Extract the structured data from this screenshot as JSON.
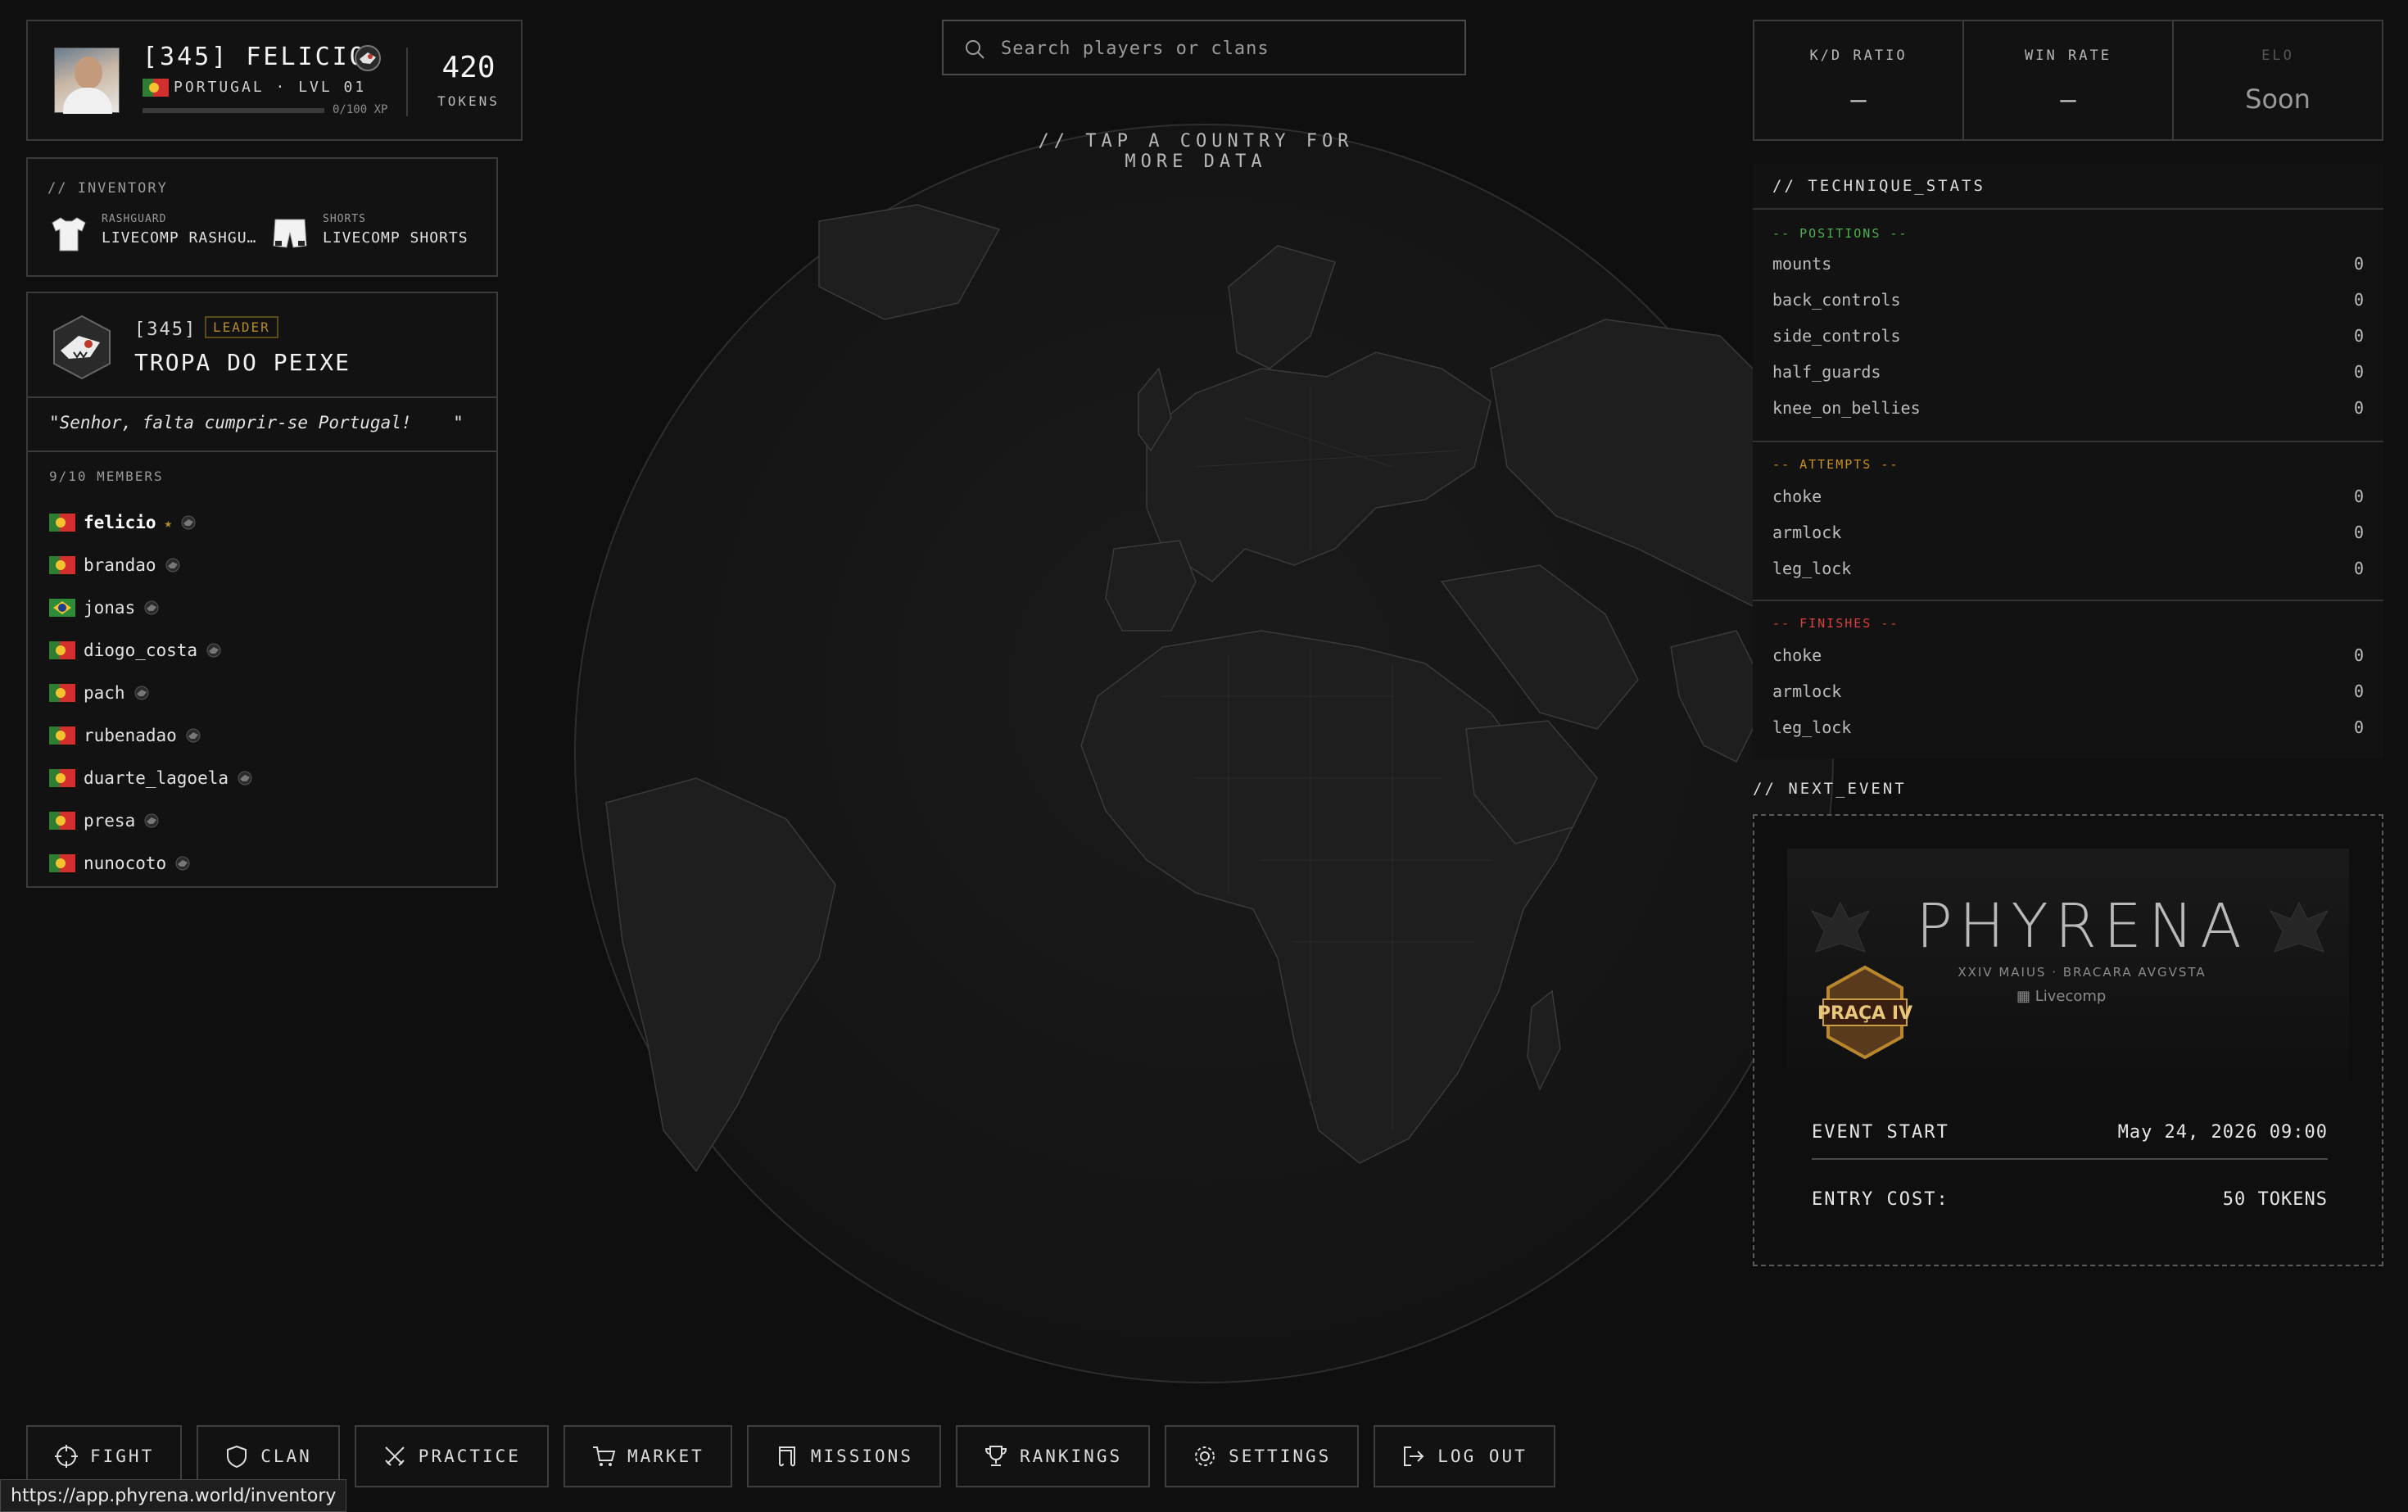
{
  "profile": {
    "name": "[345] FELICIO",
    "country_level": "PORTUGAL · LVL 01",
    "xp_text": "0/100 XP",
    "xp_progress": 0.0,
    "tokens_value": "420",
    "tokens_label": "TOKENS"
  },
  "inventory": {
    "title": "// INVENTORY",
    "items": [
      {
        "type": "RASHGUARD",
        "name": "LIVECOMP RASHGU…"
      },
      {
        "type": "SHORTS",
        "name": "LIVECOMP SHORTS"
      }
    ]
  },
  "clan": {
    "tag": "[345]",
    "role": "LEADER",
    "name": "TROPA DO PEIXE",
    "motto": "\"Senhor, falta cumprir-se Portugal!    \"",
    "members_count": "9/10 MEMBERS",
    "members": [
      {
        "name": "felicio",
        "flag": "pt",
        "leader": true
      },
      {
        "name": "brandao",
        "flag": "pt",
        "leader": false
      },
      {
        "name": "jonas",
        "flag": "br",
        "leader": false
      },
      {
        "name": "diogo_costa",
        "flag": "pt",
        "leader": false
      },
      {
        "name": "pach",
        "flag": "pt",
        "leader": false
      },
      {
        "name": "rubenadao",
        "flag": "pt",
        "leader": false
      },
      {
        "name": "duarte_lagoela",
        "flag": "pt",
        "leader": false
      },
      {
        "name": "presa",
        "flag": "pt",
        "leader": false
      },
      {
        "name": "nunocoto",
        "flag": "pt",
        "leader": false
      }
    ],
    "leader_star": "★"
  },
  "search": {
    "placeholder": "Search players or clans"
  },
  "map": {
    "hint": "// TAP A COUNTRY FOR MORE DATA"
  },
  "stats": [
    {
      "label": "K/D RATIO",
      "value": "—"
    },
    {
      "label": "WIN RATE",
      "value": "—"
    },
    {
      "label": "ELO",
      "value": "Soon"
    }
  ],
  "technique": {
    "title": "// TECHNIQUE_STATS",
    "groups": [
      {
        "title": "-- POSITIONS --",
        "color": "#4caf50",
        "rows": [
          [
            "mounts",
            "0"
          ],
          [
            "back_controls",
            "0"
          ],
          [
            "side_controls",
            "0"
          ],
          [
            "half_guards",
            "0"
          ],
          [
            "knee_on_bellies",
            "0"
          ]
        ]
      },
      {
        "title": "-- ATTEMPTS --",
        "color": "#c99020",
        "rows": [
          [
            "choke",
            "0"
          ],
          [
            "armlock",
            "0"
          ],
          [
            "leg_lock",
            "0"
          ]
        ]
      },
      {
        "title": "-- FINISHES --",
        "color": "#d64040",
        "rows": [
          [
            "choke",
            "0"
          ],
          [
            "armlock",
            "0"
          ],
          [
            "leg_lock",
            "0"
          ]
        ]
      }
    ]
  },
  "next_event": {
    "title": "// NEXT_EVENT",
    "banner_brand": "PHYRENA",
    "banner_sub": "XXIV MAIUS · BRACARA AVGVSTA",
    "banner_partner": "Livecomp",
    "banner_badge": "PRAÇA IV",
    "start_label": "EVENT START",
    "start_value": "May 24, 2026 09:00",
    "cost_label": "ENTRY COST:",
    "cost_value": "50 TOKENS"
  },
  "nav": [
    {
      "label": "FIGHT",
      "icon": "crosshair-icon"
    },
    {
      "label": "CLAN",
      "icon": "shield-icon"
    },
    {
      "label": "PRACTICE",
      "icon": "swords-icon"
    },
    {
      "label": "MARKET",
      "icon": "cart-icon"
    },
    {
      "label": "MISSIONS",
      "icon": "scroll-icon"
    },
    {
      "label": "RANKINGS",
      "icon": "trophy-icon"
    },
    {
      "label": "SETTINGS",
      "icon": "gear-icon"
    },
    {
      "label": "LOG OUT",
      "icon": "logout-icon"
    }
  ],
  "status_url": "https://app.phyrena.world/inventory"
}
